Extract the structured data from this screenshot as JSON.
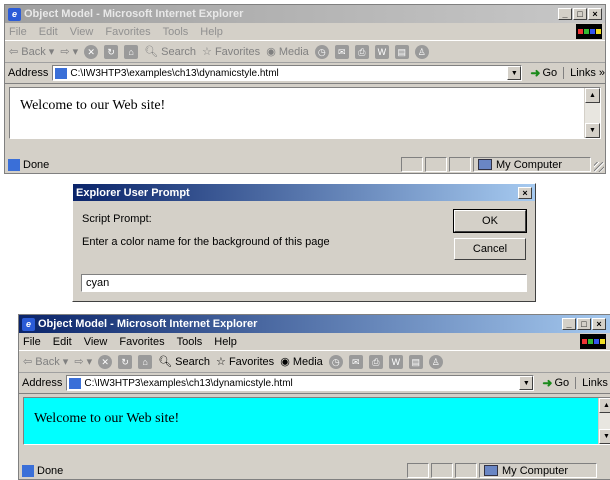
{
  "window1": {
    "title": "Object Model - Microsoft Internet Explorer",
    "menu": [
      "File",
      "Edit",
      "View",
      "Favorites",
      "Tools",
      "Help"
    ],
    "toolbar": {
      "back": "Back",
      "search": "Search",
      "favorites": "Favorites",
      "media": "Media"
    },
    "address": {
      "label": "Address",
      "url": "C:\\IW3HTP3\\examples\\ch13\\dynamicstyle.html",
      "go": "Go",
      "links": "Links »"
    },
    "content": {
      "message": "Welcome to our Web site!",
      "background": "#ffffff"
    },
    "status": {
      "text": "Done",
      "zone": "My Computer"
    }
  },
  "dialog": {
    "title": "Explorer User Prompt",
    "script_prompt": "Script Prompt:",
    "message": "Enter a color name for the background of this page",
    "ok": "OK",
    "cancel": "Cancel",
    "input_value": "cyan"
  },
  "window2": {
    "title": "Object Model - Microsoft Internet Explorer",
    "menu": [
      "File",
      "Edit",
      "View",
      "Favorites",
      "Tools",
      "Help"
    ],
    "toolbar": {
      "back": "Back",
      "search": "Search",
      "favorites": "Favorites",
      "media": "Media"
    },
    "address": {
      "label": "Address",
      "url": "C:\\IW3HTP3\\examples\\ch13\\dynamicstyle.html",
      "go": "Go",
      "links": "Links »"
    },
    "content": {
      "message": "Welcome to our Web site!",
      "background": "#00ffff"
    },
    "status": {
      "text": "Done",
      "zone": "My Computer"
    }
  },
  "colors": {
    "title_active": "#0a246a",
    "cyan": "#00ffff",
    "chrome": "#d4d0c8"
  }
}
